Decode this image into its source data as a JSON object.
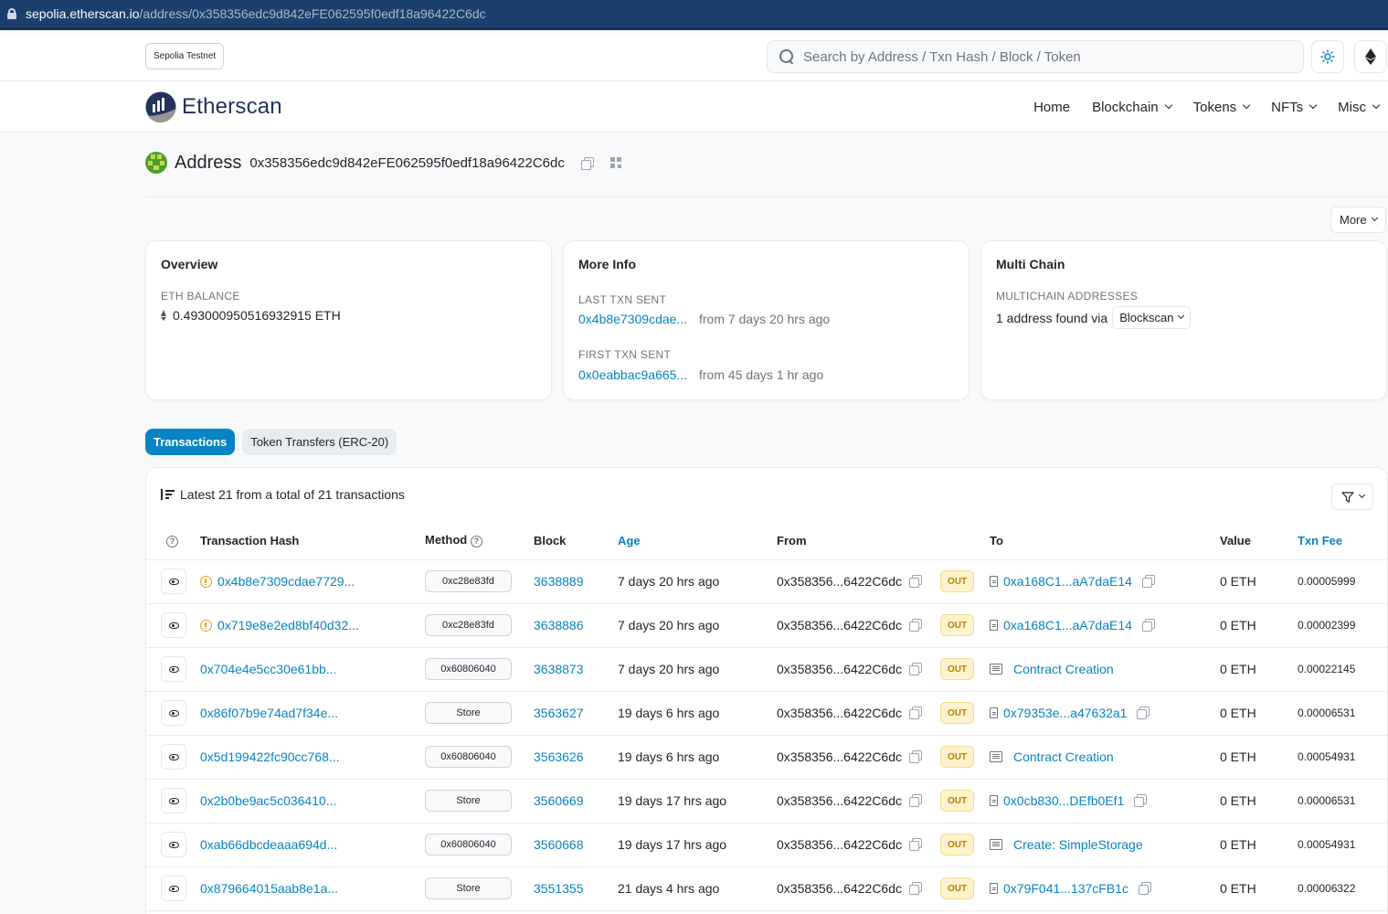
{
  "browser": {
    "url_host": "sepolia.etherscan.io",
    "url_path": "/address/0x358356edc9d842eFE062595f0edf18a96422C6dc"
  },
  "topbar": {
    "network": "Sepolia Testnet",
    "search_placeholder": "Search by Address / Txn Hash / Block / Token"
  },
  "brand": {
    "name": "Etherscan"
  },
  "nav": {
    "home": "Home",
    "blockchain": "Blockchain",
    "tokens": "Tokens",
    "nfts": "NFTs",
    "misc": "Misc"
  },
  "address": {
    "label": "Address",
    "value": "0x358356edc9d842eFE062595f0edf18a96422C6dc"
  },
  "more_label": "More",
  "overview": {
    "title": "Overview",
    "balance_label": "ETH BALANCE",
    "balance_value": "0.49300095051693291 5 ETH"
  },
  "more_info": {
    "title": "More Info",
    "last_label": "LAST TXN SENT",
    "last_hash": "0x4b8e7309cdae...",
    "last_age": "from 7 days 20 hrs ago",
    "first_label": "FIRST TXN SENT",
    "first_hash": "0x0eabbac9a665...",
    "first_age": "from 45 days 1 hr ago"
  },
  "multi_chain": {
    "title": "Multi Chain",
    "label": "MULTICHAIN ADDRESSES",
    "found": "1 address found via",
    "service": "Blockscan"
  },
  "tabs": {
    "transactions": "Transactions",
    "token_transfers": "Token Transfers (ERC-20)"
  },
  "tx": {
    "summary": "Latest 21 from a total of 21 transactions",
    "headers": {
      "hash": "Transaction Hash",
      "method": "Method",
      "block": "Block",
      "age": "Age",
      "from": "From",
      "to": "To",
      "value": "Value",
      "fee": "Txn Fee"
    },
    "rows": [
      {
        "hash": "0x4b8e7309cdae7729...",
        "warn": true,
        "method": "0xc28e83fd",
        "block": "3638889",
        "age": "7 days 20 hrs ago",
        "from": "0x358356...6422C6dc",
        "dir": "OUT",
        "to": "0xa168C1...aA7daE14",
        "to_type": "contract",
        "value": "0 ETH",
        "fee": "0.00005999"
      },
      {
        "hash": "0x719e8e2ed8bf40d32...",
        "warn": true,
        "method": "0xc28e83fd",
        "block": "3638886",
        "age": "7 days 20 hrs ago",
        "from": "0x358356...6422C6dc",
        "dir": "OUT",
        "to": "0xa168C1...aA7daE14",
        "to_type": "contract",
        "value": "0 ETH",
        "fee": "0.00002399"
      },
      {
        "hash": "0x704e4e5cc30e61bb...",
        "warn": false,
        "method": "0x60806040",
        "block": "3638873",
        "age": "7 days 20 hrs ago",
        "from": "0x358356...6422C6dc",
        "dir": "OUT",
        "to": "Contract Creation",
        "to_type": "creation",
        "value": "0 ETH",
        "fee": "0.00022145"
      },
      {
        "hash": "0x86f07b9e74ad7f34e...",
        "warn": false,
        "method": "Store",
        "block": "3563627",
        "age": "19 days 6 hrs ago",
        "from": "0x358356...6422C6dc",
        "dir": "OUT",
        "to": "0x79353e...a47632a1",
        "to_type": "contract",
        "value": "0 ETH",
        "fee": "0.00006531"
      },
      {
        "hash": "0x5d199422fc90cc768...",
        "warn": false,
        "method": "0x60806040",
        "block": "3563626",
        "age": "19 days 6 hrs ago",
        "from": "0x358356...6422C6dc",
        "dir": "OUT",
        "to": "Contract Creation",
        "to_type": "creation",
        "value": "0 ETH",
        "fee": "0.00054931"
      },
      {
        "hash": "0x2b0be9ac5c036410...",
        "warn": false,
        "method": "Store",
        "block": "3560669",
        "age": "19 days 17 hrs ago",
        "from": "0x358356...6422C6dc",
        "dir": "OUT",
        "to": "0x0cb830...DEfb0Ef1",
        "to_type": "contract",
        "value": "0 ETH",
        "fee": "0.00006531"
      },
      {
        "hash": "0xab66dbcdeaaa694d...",
        "warn": false,
        "method": "0x60806040",
        "block": "3560668",
        "age": "19 days 17 hrs ago",
        "from": "0x358356...6422C6dc",
        "dir": "OUT",
        "to": "Create: SimpleStorage",
        "to_type": "creation",
        "value": "0 ETH",
        "fee": "0.00054931"
      },
      {
        "hash": "0x879664015aab8e1a...",
        "warn": false,
        "method": "Store",
        "block": "3551355",
        "age": "21 days 4 hrs ago",
        "from": "0x358356...6422C6dc",
        "dir": "OUT",
        "to": "0x79F041...137cFB1c",
        "to_type": "contract",
        "value": "0 ETH",
        "fee": "0.00006322"
      }
    ]
  }
}
